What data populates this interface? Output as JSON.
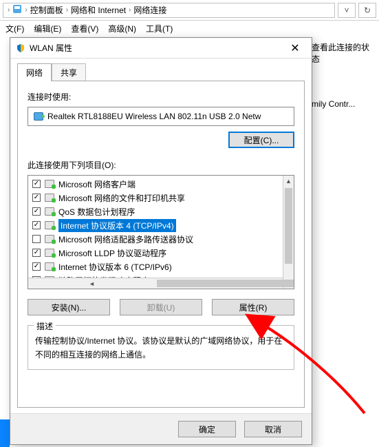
{
  "breadcrumb": {
    "items": [
      "控制面板",
      "网络和 Internet",
      "网络连接"
    ]
  },
  "menubar": {
    "file": "文(F)",
    "edit": "编辑(E)",
    "view": "查看(V)",
    "advanced": "高级(N)",
    "tools": "工具(T)"
  },
  "rightpane": {
    "header": "查看此连接的状态",
    "truncated": "mily Contr..."
  },
  "dialog": {
    "title": "WLAN 属性",
    "tabs": {
      "network": "网络",
      "share": "共享"
    },
    "connect_using_label": "连接时使用:",
    "adapter_name": "Realtek RTL8188EU Wireless LAN 802.11n USB 2.0 Netw",
    "configure_btn": "配置(C)...",
    "items_label": "此连接使用下列项目(O):",
    "items": [
      {
        "checked": true,
        "name": "Microsoft 网络客户端",
        "selected": false,
        "iconClass": "green"
      },
      {
        "checked": true,
        "name": "Microsoft 网络的文件和打印机共享",
        "selected": false,
        "iconClass": "green"
      },
      {
        "checked": true,
        "name": "QoS 数据包计划程序",
        "selected": false,
        "iconClass": "green"
      },
      {
        "checked": true,
        "name": "Internet 协议版本 4 (TCP/IPv4)",
        "selected": true,
        "iconClass": "green"
      },
      {
        "checked": false,
        "name": "Microsoft 网络适配器多路传送器协议",
        "selected": false,
        "iconClass": "green"
      },
      {
        "checked": true,
        "name": "Microsoft LLDP 协议驱动程序",
        "selected": false,
        "iconClass": "green"
      },
      {
        "checked": true,
        "name": "Internet 协议版本 6 (TCP/IPv6)",
        "selected": false,
        "iconClass": "green"
      },
      {
        "checked": true,
        "name": "链路层拓扑发现响应程序",
        "selected": false,
        "iconClass": "link"
      }
    ],
    "install_btn": "安装(N)...",
    "uninstall_btn": "卸载(U)",
    "properties_btn": "属性(R)",
    "desc_legend": "描述",
    "desc_text": "传输控制协议/Internet 协议。该协议是默认的广域网络协议，用于在不同的相互连接的网络上通信。",
    "ok_btn": "确定",
    "cancel_btn": "取消"
  }
}
